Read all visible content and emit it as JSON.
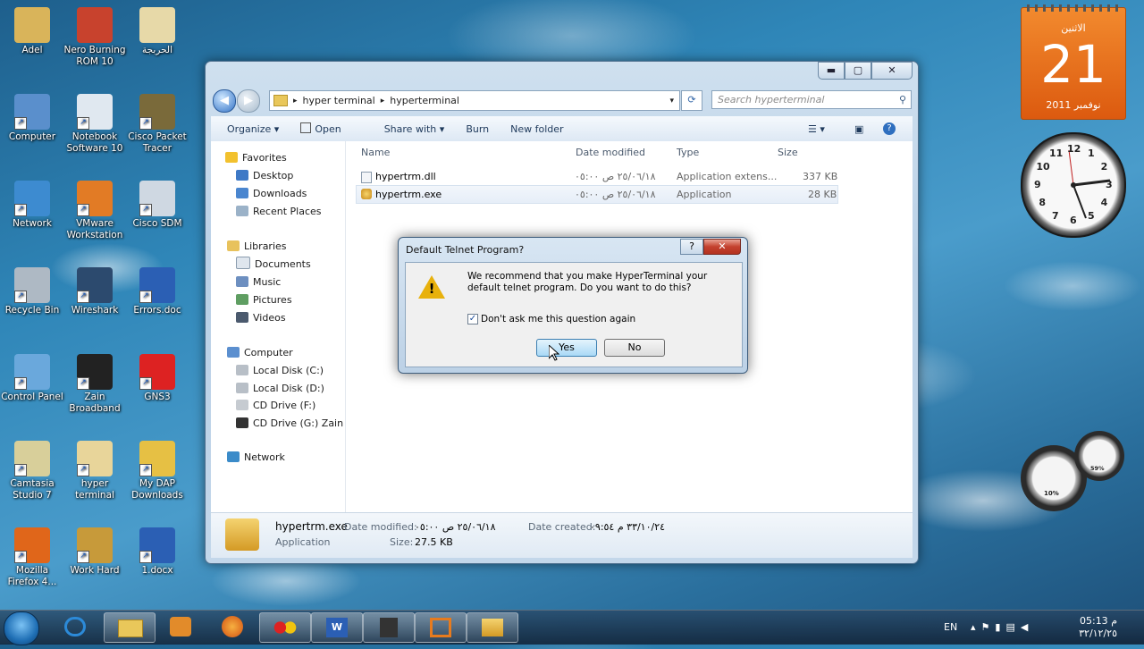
{
  "desktop": {
    "icons": [
      {
        "label": "Adel"
      },
      {
        "label": "Nero Burning ROM 10"
      },
      {
        "label": "الحربجة"
      },
      {
        "label": "Computer"
      },
      {
        "label": "Notebook Software 10"
      },
      {
        "label": "Cisco Packet Tracer"
      },
      {
        "label": "Network"
      },
      {
        "label": "VMware Workstation"
      },
      {
        "label": "Cisco SDM"
      },
      {
        "label": "Recycle Bin"
      },
      {
        "label": "Wireshark"
      },
      {
        "label": "Errors.doc"
      },
      {
        "label": "Control Panel"
      },
      {
        "label": "Zain Broadband"
      },
      {
        "label": "GNS3"
      },
      {
        "label": "Camtasia Studio 7"
      },
      {
        "label": "hyper terminal"
      },
      {
        "label": "My DAP Downloads"
      },
      {
        "label": "Mozilla Firefox 4..."
      },
      {
        "label": "Work Hard"
      },
      {
        "label": "1.docx"
      }
    ]
  },
  "explorer": {
    "breadcrumb": [
      "hyper terminal",
      "hyperterminal"
    ],
    "search_placeholder": "Search hyperterminal",
    "toolbar": {
      "organize": "Organize ▾",
      "open": "Open",
      "share": "Share with ▾",
      "burn": "Burn",
      "new_folder": "New folder"
    },
    "nav": {
      "favorites": "Favorites",
      "desktop": "Desktop",
      "downloads": "Downloads",
      "recent": "Recent Places",
      "libraries": "Libraries",
      "documents": "Documents",
      "music": "Music",
      "pictures": "Pictures",
      "videos": "Videos",
      "computer": "Computer",
      "disk_c": "Local Disk (C:)",
      "disk_d": "Local Disk (D:)",
      "cd_f": "CD Drive (F:)",
      "cd_g": "CD Drive (G:) Zain Br",
      "network": "Network"
    },
    "columns": {
      "name": "Name",
      "date": "Date modified",
      "type": "Type",
      "size": "Size"
    },
    "files": [
      {
        "name": "hypertrm.dll",
        "date": "٢٥/٠٦/١٨ ص ٠٥:٠٠",
        "type": "Application extens...",
        "size": "337 KB"
      },
      {
        "name": "hypertrm.exe",
        "date": "٢٥/٠٦/١٨ ص ٠٥:٠٠",
        "type": "Application",
        "size": "28 KB"
      }
    ],
    "details": {
      "name": "hypertrm.exe",
      "kind": "Application",
      "modified_label": "Date modified:",
      "modified": "٢٥/٠٦/١٨ ص ٠٥:٠٠",
      "created_label": "Date created:",
      "created": "٣٣/١٠/٢٤ م ٠٩:٥٤",
      "size_label": "Size:",
      "size": "27.5 KB"
    }
  },
  "dialog": {
    "title": "Default Telnet Program?",
    "message": "We recommend that you make HyperTerminal your default telnet program.  Do you want to do this?",
    "checkbox": "Don't ask me this question again",
    "checkbox_checked": true,
    "yes": "Yes",
    "no": "No"
  },
  "gadgets": {
    "calendar": {
      "day_name": "الاثنين",
      "day": "21",
      "month_year": "نوفمبر 2011"
    },
    "clock_numbers": [
      "12",
      "1",
      "2",
      "3",
      "4",
      "5",
      "6",
      "7",
      "8",
      "9",
      "10",
      "11"
    ],
    "cpu_percent": "10%",
    "memory_percent": "59%"
  },
  "taskbar": {
    "language": "EN",
    "time": "05:13 م",
    "date": "٣٢/١٢/٢٥"
  }
}
